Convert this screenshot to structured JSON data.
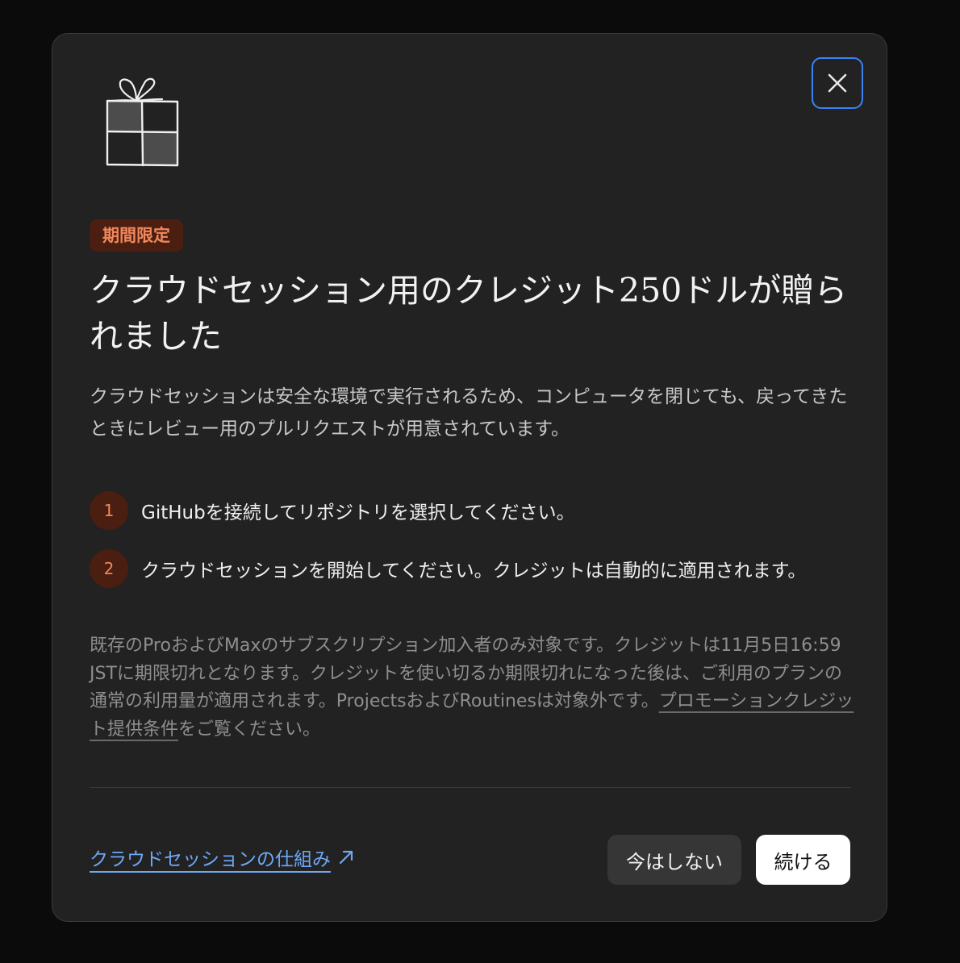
{
  "modal": {
    "badge": "期間限定",
    "title": "クラウドセッション用のクレジット250ドルが贈られました",
    "description": "クラウドセッションは安全な環境で実行されるため、コンピュータを閉じても、戻ってきたときにレビュー用のプルリクエストが用意されています。",
    "steps": [
      {
        "number": "1",
        "text": "GitHubを接続してリポジトリを選択してください。"
      },
      {
        "number": "2",
        "text": "クラウドセッションを開始してください。クレジットは自動的に適用されます。"
      }
    ],
    "fineprint": {
      "text": "既存のProおよびMaxのサブスクリプション加入者のみ対象です。クレジットは11月5日16:59 JSTに期限切れとなります。クレジットを使い切るか期限切れになった後は、ご利用のプランの通常の利用量が適用されます。ProjectsおよびRoutinesは対象外です。",
      "link": "プロモーションクレジット提供条件",
      "suffix": "をご覧ください。"
    },
    "footer": {
      "learn_link": "クラウドセッションの仕組み",
      "dismiss_label": "今はしない",
      "continue_label": "続ける"
    }
  },
  "icons": {
    "close": "close-icon",
    "gift": "gift-icon",
    "external": "arrow-up-right-icon"
  },
  "colors": {
    "backdrop": "#0b0b0b",
    "modal_bg": "#222222",
    "accent": "#f0875a",
    "accent_bg": "#4a1e10",
    "link": "#6ea8f5",
    "focus_ring": "#3b82f6"
  }
}
